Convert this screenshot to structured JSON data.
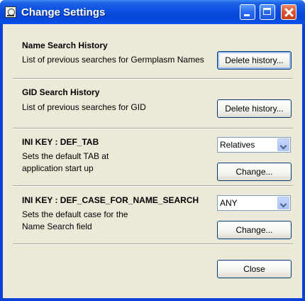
{
  "window": {
    "title": "Change Settings"
  },
  "sections": {
    "name_search": {
      "header": "Name Search History",
      "description": "List of previous searches for Germplasm Names",
      "button": "Delete history..."
    },
    "gid_search": {
      "header": "GID Search History",
      "description": "List of previous searches for GID",
      "button": "Delete history..."
    },
    "def_tab": {
      "header": "INI KEY : DEF_TAB",
      "description_line1": "Sets the default TAB at",
      "description_line2": "application start up",
      "selected": "Relatives",
      "button": "Change..."
    },
    "def_case": {
      "header": "INI KEY : DEF_CASE_FOR_NAME_SEARCH",
      "description_line1": "Sets the default case for the",
      "description_line2": "Name Search field",
      "selected": "ANY",
      "button": "Change..."
    }
  },
  "footer": {
    "close_label": "Close"
  }
}
